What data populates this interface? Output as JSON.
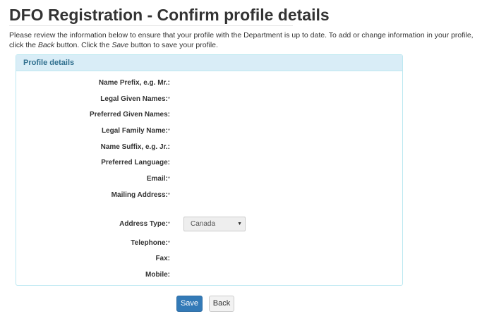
{
  "header": {
    "title": "DFO Registration - Confirm profile details"
  },
  "intro": {
    "part1": "Please review the information below to ensure that your profile with the Department is up to date. To add or change information in your profile, click the ",
    "back_word": "Back",
    "part2": " button. Click the ",
    "save_word": "Save",
    "part3": " button to save your profile."
  },
  "panel": {
    "heading": "Profile details",
    "fields": {
      "name_prefix": {
        "label": "Name Prefix, e.g. Mr.:",
        "required": ""
      },
      "legal_given_names": {
        "label": "Legal Given Names:",
        "required": "*"
      },
      "preferred_given_names": {
        "label": "Preferred Given Names:",
        "required": ""
      },
      "legal_family_name": {
        "label": "Legal Family Name:",
        "required": "*"
      },
      "name_suffix": {
        "label": "Name Suffix, e.g. Jr.:",
        "required": ""
      },
      "preferred_language": {
        "label": "Preferred Language:",
        "required": ""
      },
      "email": {
        "label": "Email:",
        "required": "*"
      },
      "mailing_address": {
        "label": "Mailing Address:",
        "required": "*"
      },
      "address_type": {
        "label": "Address Type:",
        "required": "*",
        "selected": "Canada"
      },
      "telephone": {
        "label": "Telephone:",
        "required": "*"
      },
      "fax": {
        "label": "Fax:",
        "required": ""
      },
      "mobile": {
        "label": "Mobile:",
        "required": ""
      }
    }
  },
  "actions": {
    "save_label": "Save",
    "back_label": "Back"
  },
  "colors": {
    "panel_heading_bg": "#d9edf7",
    "panel_heading_text": "#31708f",
    "primary_button": "#337ab7"
  },
  "icons": {
    "select_arrow": "caret-down-icon"
  }
}
